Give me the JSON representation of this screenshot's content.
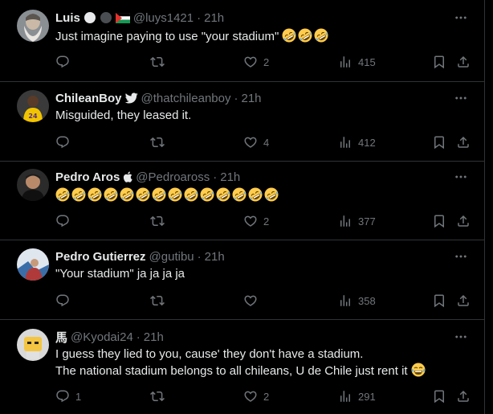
{
  "tweets": [
    {
      "name": "Luis",
      "handle": "@luys1421",
      "time": "21h",
      "text": "Just imagine paying to use \"your stadium\"",
      "emoji_count": 3,
      "emoji_name": "rolling-on-floor-laughing",
      "replies": "",
      "retweets": "",
      "likes": "2",
      "views": "415",
      "badges": [
        "white-circle",
        "dark-circle",
        "palestine-flag"
      ]
    },
    {
      "name": "ChileanBoy",
      "handle": "@thatchileanboy",
      "time": "21h",
      "text": "Misguided, they leased it.",
      "emoji_count": 0,
      "replies": "",
      "retweets": "",
      "likes": "4",
      "views": "412",
      "badges": [
        "twitter-bird"
      ]
    },
    {
      "name": "Pedro Aros",
      "handle": "@Pedroaross",
      "time": "21h",
      "text": "",
      "emoji_count": 14,
      "emoji_name": "rolling-on-floor-laughing",
      "replies": "",
      "retweets": "",
      "likes": "2",
      "views": "377",
      "badges": [
        "apple"
      ]
    },
    {
      "name": "Pedro Gutierrez",
      "handle": "@gutibu",
      "time": "21h",
      "text": "\"Your stadium\" ja ja ja ja",
      "emoji_count": 0,
      "replies": "",
      "retweets": "",
      "likes": "",
      "views": "358",
      "badges": []
    },
    {
      "name": "馬",
      "handle": "@Kyodai24",
      "time": "21h",
      "text_line1": "I guess they lied to you, cause' they don't have a stadium.",
      "text_line2": "The national stadium belongs to all chileans, U de Chile just rent it",
      "emoji_name": "face-with-tears-of-joy",
      "replies": "1",
      "retweets": "",
      "likes": "2",
      "views": "291",
      "badges": []
    }
  ],
  "colors": {
    "background": "#000000",
    "text": "#e7e9ea",
    "muted": "#71767b",
    "divider": "#2f3336"
  }
}
